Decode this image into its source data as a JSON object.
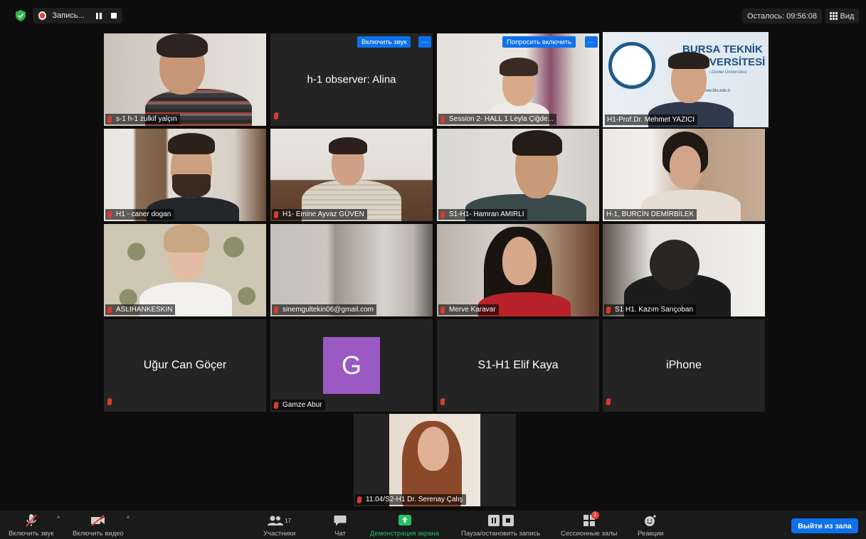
{
  "topbar": {
    "recording_label": "Запись...",
    "timer_text": "Осталось: 09:56:08",
    "view_label": "Вид"
  },
  "tiles": {
    "t1": {
      "name": "s-1 h-1 zulkif yalçın"
    },
    "t2": {
      "center": "h-1 observer: Alina",
      "unmute_btn": "Включить звук",
      "more": "···"
    },
    "t3": {
      "name": "Session 2- HALL 1 Leyla Çiğde...",
      "ask_btn": "Попросить включить",
      "more": "···"
    },
    "t4": {
      "name": "H1-Prof.Dr. Mehmet YAZICI",
      "banner_title": "BURSA TEKNİK",
      "banner_title2": "VERSİTESİ",
      "banner_sub": "i Devlet Üniversitesi",
      "banner_url": "www.btu.edu.tr"
    },
    "t5": {
      "name": "H1 - caner dogan"
    },
    "t6": {
      "name": "H1- Emine Ayvaz GÜVEN"
    },
    "t7": {
      "name": "S1-H1- Hamran AMIRLI"
    },
    "t8": {
      "name": "H-1, BURCİN DEMİRBİLEK"
    },
    "t9": {
      "name": "ASLIHANKESKIN"
    },
    "t10": {
      "name": "sinemgultekin06@gmail.com"
    },
    "t11": {
      "name": "Merve Karavar"
    },
    "t12": {
      "name": "S1 H1. Kazım Sarıçoban"
    },
    "t13": {
      "center": "Uğur Can Göçer"
    },
    "t14": {
      "name": "Gamze Abur",
      "avatar_letter": "G"
    },
    "t15": {
      "center": "S1-H1 Elif Kaya"
    },
    "t16": {
      "center": "iPhone"
    },
    "t17": {
      "name": "11.04/S2-H1 Dr. Serenay Çalış"
    }
  },
  "toolbar": {
    "unmute": "Включить звук",
    "start_video": "Включить видео",
    "participants": "Участники",
    "participants_count": "17",
    "chat": "Чат",
    "share_screen": "Демонстрация экрана",
    "pause_record": "Пауза/остановить запись",
    "breakout": "Сессионные залы",
    "breakout_badge": "1",
    "reactions": "Реакции",
    "leave": "Выйти из зала",
    "share_color": "#21c35f"
  }
}
